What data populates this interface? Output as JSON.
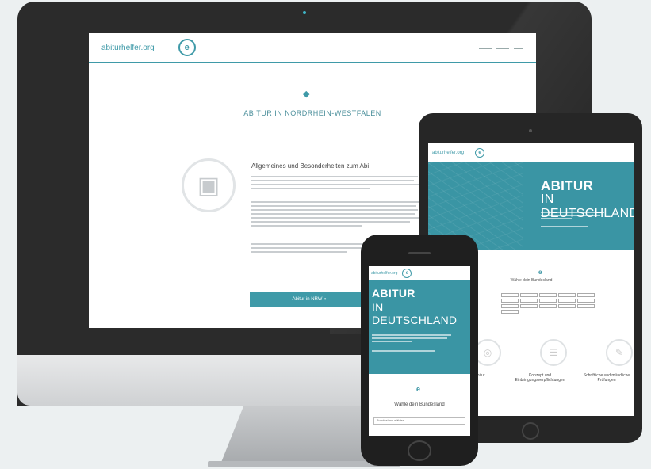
{
  "imac": {
    "site": {
      "logo_text": "abiturhelfer.org",
      "logo_mark": "e",
      "page_title": "ABITUR IN NORDRHEIN-WESTFALEN",
      "section_title": "Allgemeines und Besonderheiten zum Abi",
      "cta_label": "Abitur in NRW »"
    }
  },
  "ipad": {
    "site": {
      "logo_text": "abiturhelfer.org",
      "logo_mark": "e",
      "hero_title_1": "ABITUR",
      "hero_title_2": "IN DEUTSCHLAND",
      "symbol": "e",
      "subtitle": "Wähle dein Bundesland",
      "features": [
        "Abitur",
        "Konzept und Einbringungsverpflichtungen",
        "Schriftliche und mündliche Prüfungen"
      ]
    }
  },
  "iphone": {
    "site": {
      "logo_text": "abiturhelfer.org",
      "logo_mark": "e",
      "hero_title_1": "ABITUR",
      "hero_title_2": "IN DEUTSCHLAND",
      "symbol": "e",
      "subtitle": "Wähle dein Bundesland",
      "select_placeholder": "Bundesland wählen"
    }
  }
}
